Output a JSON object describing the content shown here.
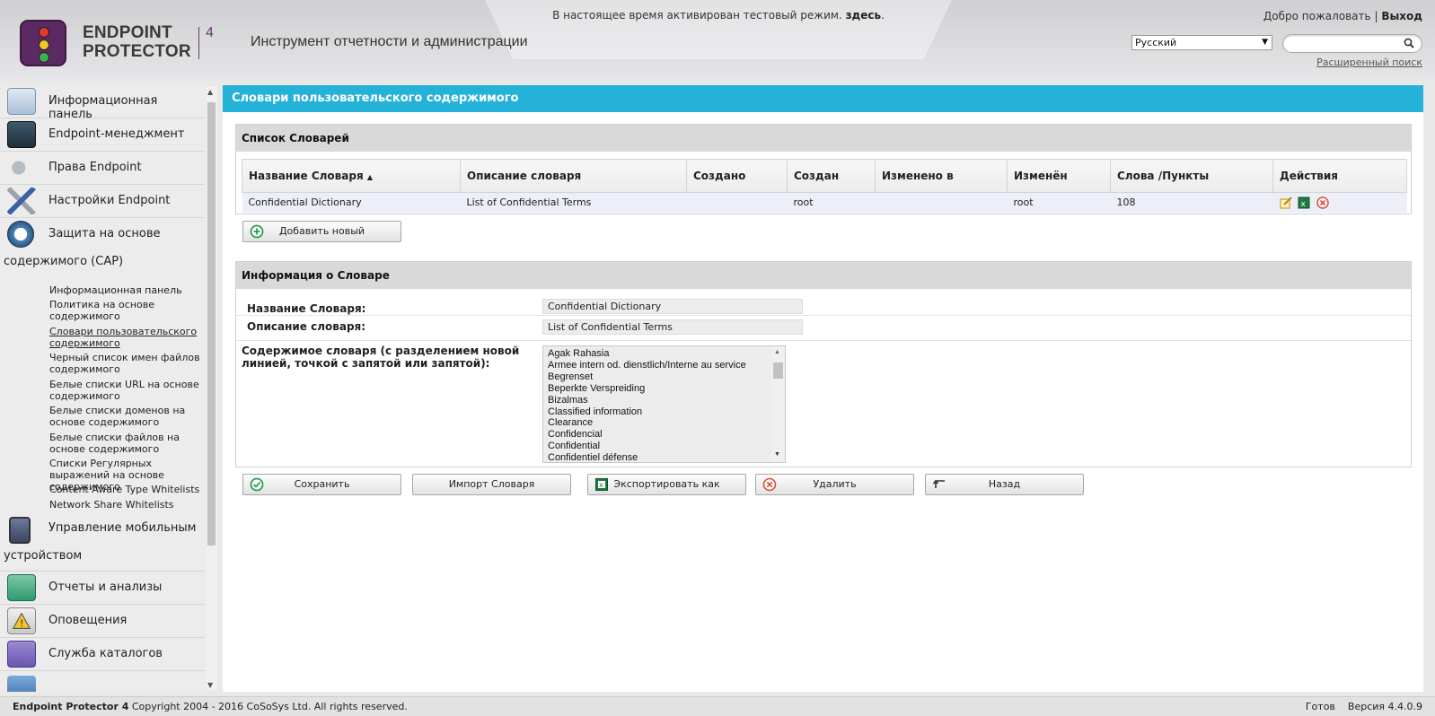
{
  "header": {
    "trial_text": "В настоящее время активирован тестовый режим.",
    "trial_link": "здесь",
    "trial_end": ".",
    "brand_line1": "ENDPOINT",
    "brand_line2": "PROTECTOR",
    "brand_version": "4",
    "tool_title": "Инструмент отчетности и администрации",
    "welcome": "Добро пожаловать",
    "separator": "|",
    "logout": "Выход",
    "language": "Русский",
    "search_value": "",
    "advanced_search": "Расширенный поиск"
  },
  "sidebar": {
    "items": [
      {
        "label": "Информационная панель",
        "icon": "dashboard-icon"
      },
      {
        "label": "Endpoint-менеджмент",
        "icon": "endpoint-management-icon"
      },
      {
        "label": "Права Endpoint",
        "icon": "keys-icon"
      },
      {
        "label": "Настройки Endpoint",
        "icon": "tools-icon"
      },
      {
        "label": "Защита на основе",
        "label2": "содержимого (CAP)",
        "icon": "content-protection-icon"
      },
      {
        "label": "Управление мобильным",
        "label2": "устройством",
        "icon": "mobile-device-icon"
      },
      {
        "label": "Отчеты и анализы",
        "icon": "reports-icon"
      },
      {
        "label": "Оповещения",
        "icon": "alerts-icon"
      },
      {
        "label": "Служба каталогов",
        "icon": "directory-services-icon"
      }
    ],
    "subitems": [
      "Информационная панель",
      "Политика на основе содержимого",
      "Словари пользовательского содержимого",
      "Черный список имен файлов содержимого",
      "Белые списки URL на основе содержимого",
      "Белые списки доменов на основе содержимого",
      "Белые списки файлов на основе содержимого",
      "Списки Регулярных выражений на основе содержимого",
      "Content Aware Type Whitelists",
      "Network Share Whitelists"
    ]
  },
  "main": {
    "title": "Словари пользовательского содержимого",
    "list_panel_title": "Список Словарей",
    "columns": [
      "Название Словаря",
      "Описание словаря",
      "Создано",
      "Создан",
      "Изменено в",
      "Изменён",
      "Слова /Пункты",
      "Действия"
    ],
    "sort_indicator": "▲",
    "rows": [
      {
        "name": "Confidential Dictionary",
        "description": "List of Confidential Terms",
        "created_at": "",
        "created_by": "root",
        "modified_at": "",
        "modified_by": "root",
        "count": "108"
      }
    ],
    "add_new": "Добавить новый",
    "info_panel_title": "Информация о Словаре",
    "name_label": "Название Словаря:",
    "name_value": "Confidential Dictionary",
    "desc_label": "Описание словаря:",
    "desc_value": "List of Confidential Terms",
    "content_label": "Содержимое словаря (с разделением новой линией, точкой с запятой или запятой):",
    "content_lines": [
      "Agak Rahasia",
      "Armee intern od. dienstlich/Interne au service",
      "Begrenset",
      "Beperkte Verspreiding",
      "Bizalmas",
      "Classified information",
      "Clearance",
      "Confidencial",
      "Confidential",
      "Confidentiel défense"
    ],
    "buttons": {
      "save": "Сохранить",
      "import": "Импорт Словаря",
      "export": "Экспортировать как",
      "delete": "Удалить",
      "back": "Назад"
    },
    "colors": {
      "title_bar": "#25b2d9",
      "row_bg": "#eceef8"
    }
  },
  "footer": {
    "product": "Endpoint Protector 4",
    "copyright": "Copyright 2004 - 2016 CoSoSys Ltd. All rights reserved.",
    "status": "Готов",
    "version": "Версия 4.4.0.9"
  }
}
